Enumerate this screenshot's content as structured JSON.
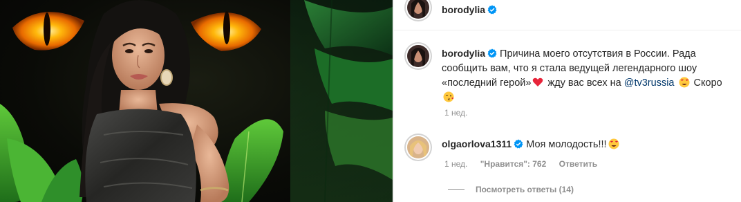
{
  "post": {
    "author": "borodylia"
  },
  "caption": {
    "username": "borodylia",
    "text_part1": "Причина моего отсутствия в России. Рада сообщить вам, что я стала ведущей легендарного шоу «последний герой»",
    "text_part2": " жду вас всех на ",
    "mention": "@tv3russia",
    "text_part3": " Скоро",
    "time": "1 нед."
  },
  "comments": [
    {
      "username": "olgaorlova1311",
      "text": "Моя молодость!!!",
      "time": "1 нед.",
      "likes": "\"Нравится\": 762",
      "reply_label": "Ответить",
      "view_replies": "Посмотреть ответы (14)"
    }
  ],
  "colors": {
    "verified": "#0095f6",
    "story_ring": "#d8256c",
    "mention": "#00376b",
    "meta_gray": "#8e8e8e"
  }
}
